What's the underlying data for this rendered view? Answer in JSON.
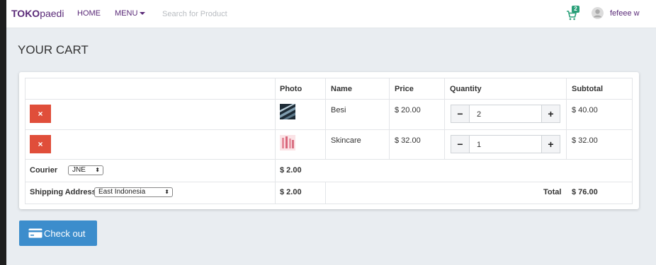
{
  "navbar": {
    "brand_bold": "TOKO",
    "brand_rest": "paedi",
    "home": "HOME",
    "menu": "MENU",
    "search_placeholder": "Search for Product",
    "cart_count": "2",
    "username": "fefeee w"
  },
  "page": {
    "title": "YOUR CART"
  },
  "table": {
    "headers": {
      "photo": "Photo",
      "name": "Name",
      "price": "Price",
      "quantity": "Quantity",
      "subtotal": "Subtotal"
    },
    "remove_label": "×",
    "rows": [
      {
        "name": "Besi",
        "price": "$ 20.00",
        "quantity": "2",
        "subtotal": "$ 40.00"
      },
      {
        "name": "Skincare",
        "price": "$ 32.00",
        "quantity": "1",
        "subtotal": "$ 32.00"
      }
    ],
    "courier": {
      "label": "Courier",
      "selected": "JNE",
      "cost": "$ 2.00"
    },
    "shipping": {
      "label": "Shipping Address",
      "selected": "East Indonesia",
      "cost": "$ 2.00"
    },
    "total_label": "Total",
    "total_value": "$ 76.00"
  },
  "checkout": {
    "label": "Check out"
  },
  "colors": {
    "brand": "#5a2a78",
    "remove": "#e04e3a",
    "checkout": "#3c8dcc",
    "badge": "#2aa079"
  }
}
